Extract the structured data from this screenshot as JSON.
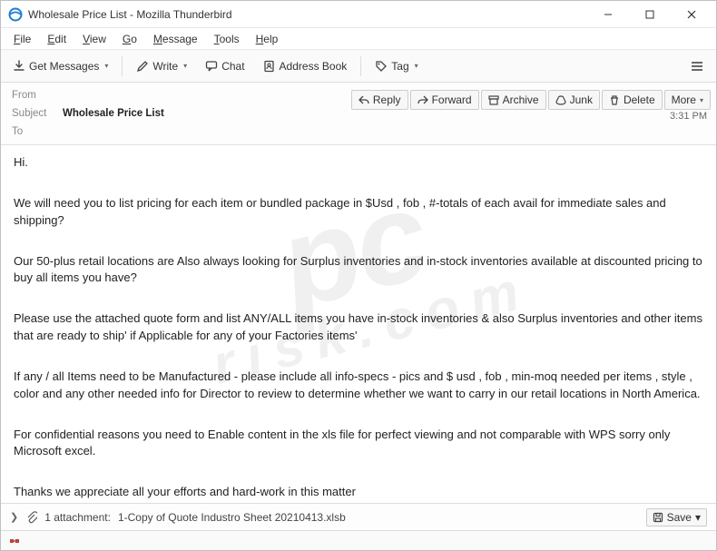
{
  "window": {
    "title": "Wholesale Price List - Mozilla Thunderbird"
  },
  "menu": {
    "file": "File",
    "edit": "Edit",
    "view": "View",
    "go": "Go",
    "message": "Message",
    "tools": "Tools",
    "help": "Help"
  },
  "toolbar": {
    "get_messages": "Get Messages",
    "write": "Write",
    "chat": "Chat",
    "address_book": "Address Book",
    "tag": "Tag"
  },
  "actions": {
    "reply": "Reply",
    "forward": "Forward",
    "archive": "Archive",
    "junk": "Junk",
    "delete": "Delete",
    "more": "More"
  },
  "headers": {
    "from_label": "From",
    "from_value": "",
    "subject_label": "Subject",
    "subject_value": "Wholesale Price List",
    "to_label": "To",
    "to_value": "",
    "time": "3:31 PM"
  },
  "body": {
    "p1": "Hi.",
    "p2": "We will need you to list pricing for each item or bundled package in $Usd , fob , #-totals of each avail for immediate sales and shipping?",
    "p3": "Our 50-plus retail locations are Also always looking for Surplus inventories and in-stock inventories available at discounted pricing to buy all items you have?",
    "p4": "Please use the attached quote form and list ANY/ALL items you have in-stock inventories & also Surplus inventories and  other items that are ready to ship' if Applicable for any of your Factories items'",
    "p5": "If any / all Items need to be Manufactured - please include all info-specs - pics and $ usd  , fob , min-moq needed per items , style , color and any other needed info for Director to review to determine whether we want to carry in our retail locations in North America.",
    "p6": "For confidential reasons you need to Enable content in the xls file for perfect viewing and not comparable with WPS sorry only Microsoft excel.",
    "p7": "Thanks  we appreciate all your efforts and hard-work in this matter"
  },
  "attachment": {
    "count_label": "1 attachment:",
    "filename": "1-Copy of Quote Industro Sheet 20210413.xlsb",
    "save": "Save"
  },
  "watermark": {
    "main": "pc",
    "sub": "risk.com"
  }
}
